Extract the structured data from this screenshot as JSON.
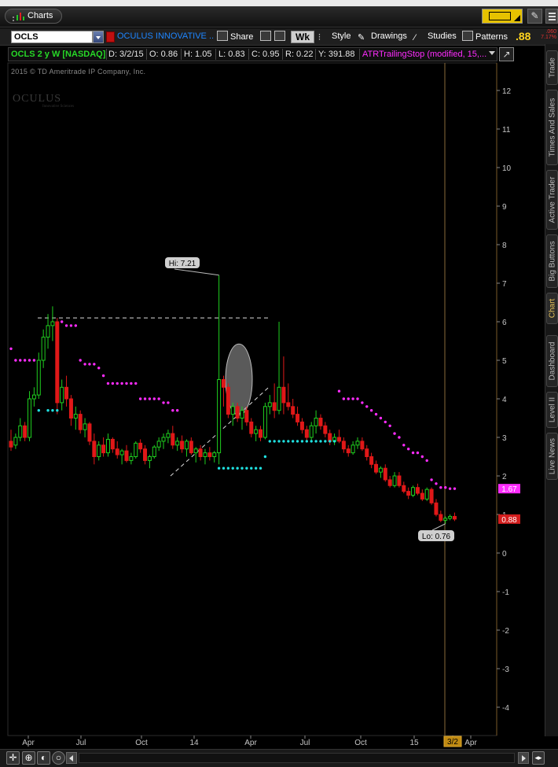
{
  "window": {
    "tab_label": "Charts"
  },
  "toolbar": {
    "symbol": "OCLS",
    "company": "OCULUS INNOVATIVE ...",
    "share": "Share",
    "aggregation": "Wk",
    "style": "Style",
    "drawings": "Drawings",
    "studies": "Studies",
    "patterns": "Patterns",
    "last_price": ".88",
    "change_top": ".060",
    "change_bottom": "7.17%"
  },
  "info": {
    "title": "OCLS 2 y W [NASDAQ]",
    "date": "D: 3/2/15",
    "open": "O: 0.86",
    "high": "H: 1.05",
    "low": "L: 0.83",
    "close": "C: 0.95",
    "range": "R: 0.22",
    "volume": "Y: 391.88",
    "study": "ATRTrailingStop (modified, 15,..."
  },
  "copyright": "2015 © TD Ameritrade IP Company, Inc.",
  "watermark": {
    "name": "OCULUS",
    "tag": "Innovative Sciences"
  },
  "sidebar_tabs": [
    "Trade",
    "Times And Sales",
    "Active Trader",
    "Big Buttons",
    "Chart",
    "Dashboard",
    "Level II",
    "Live News"
  ],
  "active_sidebar_tab": "Chart",
  "colors": {
    "up": "#1fcf1f",
    "down": "#e01818",
    "stop_up": "#1fe0e0",
    "stop_down": "#ff2cff",
    "price_tag": "#d41e1e",
    "stop_tag": "#ff2cff",
    "axis_text": "#c7c7c7"
  },
  "icons": [
    "charts-icon",
    "share-icon",
    "gear-icon",
    "wrench-icon",
    "style-icon",
    "drawings-icon",
    "studies-icon",
    "patterns-icon",
    "pin-icon",
    "list-icon",
    "crosshair-icon",
    "zoom-icon",
    "eraser-icon"
  ],
  "chart_data": {
    "type": "candlestick",
    "symbol": "OCLS",
    "period": "2 y",
    "interval": "W",
    "yaxis": {
      "ticks": [
        12,
        11,
        10,
        9,
        8,
        7,
        6,
        5,
        4,
        3,
        2,
        1,
        0,
        -1,
        -2,
        -3,
        -4
      ],
      "range": [
        -4.9,
        12.7
      ]
    },
    "xaxis": {
      "labels": [
        "Apr",
        "Jul",
        "Oct",
        "14",
        "Apr",
        "Jul",
        "Oct",
        "15",
        "3/2",
        "Apr"
      ],
      "highlighted": "3/2"
    },
    "series": [
      {
        "name": "Price",
        "kind": "ohlc",
        "bars": [
          [
            2.9,
            3.2,
            2.65,
            2.75
          ],
          [
            2.8,
            3.1,
            2.7,
            3.0
          ],
          [
            3.0,
            3.5,
            2.9,
            3.3
          ],
          [
            3.3,
            3.4,
            2.9,
            3.0
          ],
          [
            3.0,
            4.2,
            2.9,
            4.0
          ],
          [
            4.0,
            4.3,
            3.8,
            4.1
          ],
          [
            4.1,
            5.2,
            4.0,
            5.0
          ],
          [
            5.0,
            5.8,
            4.8,
            5.6
          ],
          [
            5.6,
            6.2,
            5.3,
            5.9
          ],
          [
            5.9,
            6.4,
            5.5,
            6.0
          ],
          [
            6.0,
            6.1,
            3.6,
            3.9
          ],
          [
            3.9,
            4.5,
            3.7,
            4.3
          ],
          [
            4.3,
            4.6,
            3.8,
            4.0
          ],
          [
            4.0,
            4.1,
            3.3,
            3.5
          ],
          [
            3.5,
            3.8,
            3.2,
            3.6
          ],
          [
            3.6,
            3.7,
            3.1,
            3.2
          ],
          [
            3.2,
            3.5,
            3.0,
            3.35
          ],
          [
            3.35,
            3.4,
            2.8,
            2.9
          ],
          [
            2.9,
            3.1,
            2.3,
            2.5
          ],
          [
            2.5,
            2.9,
            2.4,
            2.8
          ],
          [
            2.8,
            3.0,
            2.5,
            2.6
          ],
          [
            2.6,
            3.1,
            2.5,
            2.95
          ],
          [
            2.95,
            3.0,
            2.6,
            2.7
          ],
          [
            2.7,
            2.9,
            2.45,
            2.55
          ],
          [
            2.55,
            2.7,
            2.3,
            2.65
          ],
          [
            2.65,
            2.8,
            2.35,
            2.4
          ],
          [
            2.4,
            2.6,
            2.3,
            2.5
          ],
          [
            2.5,
            2.9,
            2.45,
            2.85
          ],
          [
            2.85,
            2.95,
            2.6,
            2.7
          ],
          [
            2.7,
            2.8,
            2.3,
            2.4
          ],
          [
            2.4,
            2.55,
            2.2,
            2.5
          ],
          [
            2.5,
            2.8,
            2.45,
            2.75
          ],
          [
            2.75,
            3.0,
            2.65,
            2.9
          ],
          [
            2.9,
            3.1,
            2.7,
            3.0
          ],
          [
            3.0,
            3.2,
            2.85,
            3.1
          ],
          [
            3.1,
            3.3,
            2.7,
            2.8
          ],
          [
            2.8,
            3.0,
            2.65,
            2.9
          ],
          [
            2.9,
            3.05,
            2.6,
            2.7
          ],
          [
            2.7,
            2.95,
            2.5,
            2.9
          ],
          [
            2.9,
            3.0,
            2.55,
            2.6
          ],
          [
            2.6,
            2.75,
            2.35,
            2.7
          ],
          [
            2.7,
            2.8,
            2.4,
            2.5
          ],
          [
            2.5,
            2.7,
            2.3,
            2.6
          ],
          [
            2.6,
            2.75,
            2.4,
            2.5
          ],
          [
            2.5,
            2.65,
            2.35,
            2.6
          ],
          [
            2.6,
            7.21,
            2.3,
            4.5
          ],
          [
            4.5,
            4.6,
            3.8,
            4.3
          ],
          [
            4.3,
            4.4,
            3.5,
            3.6
          ],
          [
            3.6,
            3.9,
            3.3,
            3.8
          ],
          [
            3.8,
            3.9,
            3.4,
            3.5
          ],
          [
            3.5,
            3.8,
            3.2,
            3.7
          ],
          [
            3.7,
            3.8,
            3.3,
            3.4
          ],
          [
            3.4,
            3.5,
            3.0,
            3.1
          ],
          [
            3.1,
            3.3,
            2.9,
            3.2
          ],
          [
            3.2,
            3.3,
            2.9,
            3.0
          ],
          [
            3.0,
            3.9,
            2.95,
            3.8
          ],
          [
            3.8,
            4.1,
            3.6,
            3.9
          ],
          [
            3.9,
            4.4,
            3.5,
            3.7
          ],
          [
            3.7,
            6.0,
            3.6,
            4.3
          ],
          [
            4.3,
            5.1,
            3.6,
            3.9
          ],
          [
            3.9,
            4.4,
            3.7,
            3.8
          ],
          [
            3.8,
            4.0,
            3.5,
            3.6
          ],
          [
            3.6,
            3.8,
            3.3,
            3.4
          ],
          [
            3.4,
            3.5,
            3.1,
            3.2
          ],
          [
            3.2,
            3.3,
            2.9,
            3.0
          ],
          [
            3.0,
            3.4,
            2.9,
            3.3
          ],
          [
            3.3,
            3.7,
            3.1,
            3.5
          ],
          [
            3.5,
            3.6,
            3.2,
            3.3
          ],
          [
            3.3,
            3.4,
            3.0,
            3.1
          ],
          [
            3.1,
            3.2,
            2.8,
            2.9
          ],
          [
            2.9,
            3.1,
            2.8,
            3.0
          ],
          [
            3.0,
            3.2,
            2.85,
            2.9
          ],
          [
            2.9,
            3.0,
            2.6,
            2.7
          ],
          [
            2.7,
            2.8,
            2.5,
            2.6
          ],
          [
            2.6,
            2.9,
            2.55,
            2.8
          ],
          [
            2.8,
            3.0,
            2.7,
            2.9
          ],
          [
            2.9,
            3.0,
            2.65,
            2.7
          ],
          [
            2.7,
            2.8,
            2.4,
            2.5
          ],
          [
            2.5,
            2.6,
            2.2,
            2.3
          ],
          [
            2.3,
            2.4,
            2.05,
            2.1
          ],
          [
            2.1,
            2.25,
            1.95,
            2.2
          ],
          [
            2.2,
            2.3,
            1.85,
            1.9
          ],
          [
            1.9,
            2.0,
            1.7,
            1.75
          ],
          [
            1.75,
            2.1,
            1.7,
            2.0
          ],
          [
            2.0,
            2.1,
            1.7,
            1.75
          ],
          [
            1.75,
            1.85,
            1.55,
            1.6
          ],
          [
            1.6,
            1.7,
            1.4,
            1.5
          ],
          [
            1.5,
            1.75,
            1.45,
            1.7
          ],
          [
            1.7,
            1.8,
            1.5,
            1.55
          ],
          [
            1.55,
            1.65,
            1.35,
            1.4
          ],
          [
            1.4,
            1.7,
            1.35,
            1.65
          ],
          [
            1.65,
            1.7,
            1.25,
            1.3
          ],
          [
            1.3,
            1.4,
            0.95,
            1.0
          ],
          [
            1.0,
            1.1,
            0.8,
            0.85
          ],
          [
            0.85,
            0.95,
            0.76,
            0.9
          ],
          [
            0.9,
            1.0,
            0.85,
            0.95
          ],
          [
            0.95,
            1.05,
            0.83,
            0.88
          ]
        ]
      },
      {
        "name": "ATRTrailingStop (up)",
        "kind": "dots",
        "points": [
          [
            0,
            null
          ],
          [
            4,
            null
          ],
          [
            6,
            3.7
          ],
          [
            8,
            3.7
          ],
          [
            9,
            3.7
          ],
          [
            10,
            3.7
          ],
          [
            45,
            2.2
          ],
          [
            46,
            2.2
          ],
          [
            47,
            2.2
          ],
          [
            48,
            2.2
          ],
          [
            49,
            2.2
          ],
          [
            50,
            2.2
          ],
          [
            51,
            2.2
          ],
          [
            52,
            2.2
          ],
          [
            53,
            2.2
          ],
          [
            54,
            2.2
          ],
          [
            55,
            2.5
          ],
          [
            56,
            2.9
          ],
          [
            57,
            2.9
          ],
          [
            58,
            2.9
          ],
          [
            59,
            2.9
          ],
          [
            60,
            2.9
          ],
          [
            61,
            2.9
          ],
          [
            62,
            2.9
          ],
          [
            63,
            2.9
          ],
          [
            64,
            2.9
          ],
          [
            65,
            2.9
          ],
          [
            66,
            2.9
          ],
          [
            67,
            2.9
          ],
          [
            68,
            2.9
          ],
          [
            69,
            2.9
          ],
          [
            70,
            2.9
          ]
        ]
      },
      {
        "name": "ATRTrailingStop (down)",
        "kind": "dots",
        "points": [
          [
            0,
            5.3
          ],
          [
            1,
            5.0
          ],
          [
            2,
            5.0
          ],
          [
            3,
            5.0
          ],
          [
            4,
            5.0
          ],
          [
            5,
            5.0
          ],
          [
            11,
            6.0
          ],
          [
            12,
            5.9
          ],
          [
            13,
            5.9
          ],
          [
            14,
            5.9
          ],
          [
            15,
            5.0
          ],
          [
            16,
            4.9
          ],
          [
            17,
            4.9
          ],
          [
            18,
            4.9
          ],
          [
            19,
            4.8
          ],
          [
            20,
            4.6
          ],
          [
            21,
            4.4
          ],
          [
            22,
            4.4
          ],
          [
            23,
            4.4
          ],
          [
            24,
            4.4
          ],
          [
            25,
            4.4
          ],
          [
            26,
            4.4
          ],
          [
            27,
            4.4
          ],
          [
            28,
            4.0
          ],
          [
            29,
            4.0
          ],
          [
            30,
            4.0
          ],
          [
            31,
            4.0
          ],
          [
            32,
            4.0
          ],
          [
            33,
            3.9
          ],
          [
            34,
            3.9
          ],
          [
            35,
            3.7
          ],
          [
            36,
            3.7
          ],
          [
            71,
            4.2
          ],
          [
            72,
            4.0
          ],
          [
            73,
            4.0
          ],
          [
            74,
            4.0
          ],
          [
            75,
            4.0
          ],
          [
            76,
            3.9
          ],
          [
            77,
            3.8
          ],
          [
            78,
            3.7
          ],
          [
            79,
            3.6
          ],
          [
            80,
            3.5
          ],
          [
            81,
            3.4
          ],
          [
            82,
            3.3
          ],
          [
            83,
            3.1
          ],
          [
            84,
            3.0
          ],
          [
            85,
            2.8
          ],
          [
            86,
            2.7
          ],
          [
            87,
            2.6
          ],
          [
            88,
            2.6
          ],
          [
            89,
            2.5
          ],
          [
            90,
            2.4
          ],
          [
            91,
            1.9
          ],
          [
            92,
            1.8
          ],
          [
            93,
            1.7
          ],
          [
            94,
            1.7
          ],
          [
            95,
            1.67
          ],
          [
            96,
            1.67
          ]
        ]
      }
    ],
    "annotations": [
      {
        "label": "Hi: 7.21",
        "value": 7.21
      },
      {
        "label": "Lo: 0.76",
        "value": 0.76
      }
    ],
    "price_tags": [
      {
        "label": "1.67",
        "value": 1.67,
        "color": "#ff2cff"
      },
      {
        "label": "0.88",
        "value": 0.88,
        "color": "#d41e1e"
      }
    ],
    "drawings": [
      {
        "type": "horizontal-dashed",
        "value": 6.1
      },
      {
        "type": "trendline-dashed",
        "from_index": 45,
        "from_value": 2.0,
        "to_index": 71,
        "to_value": 4.3
      },
      {
        "type": "ellipse-highlight",
        "index": 59,
        "low": 3.7,
        "high": 5.3
      }
    ]
  }
}
